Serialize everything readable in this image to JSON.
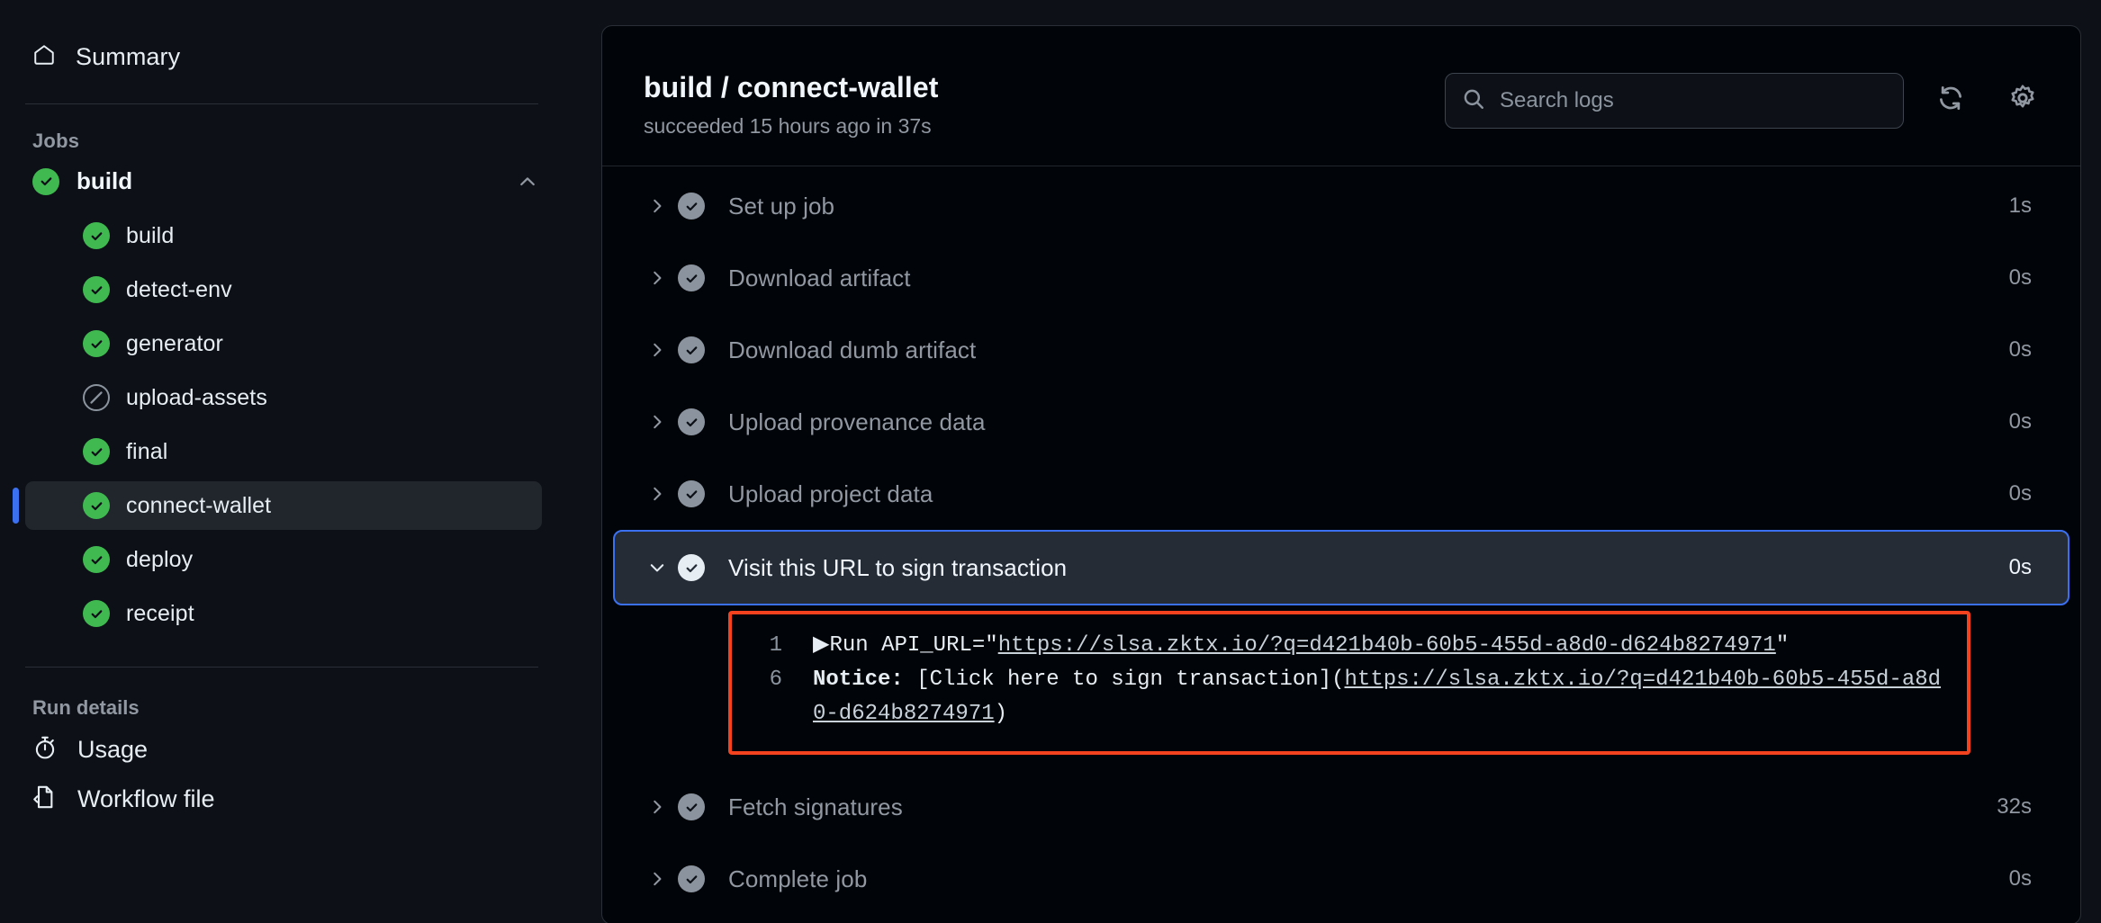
{
  "sidebar": {
    "summary": {
      "label": "Summary",
      "icon": "home-icon"
    },
    "jobs_heading": "Jobs",
    "job": {
      "label": "build",
      "status": "success",
      "expanded": true,
      "collapse_icon": "chevron-up-icon"
    },
    "steps": [
      {
        "label": "build",
        "status": "success",
        "selected": false
      },
      {
        "label": "detect-env",
        "status": "success",
        "selected": false
      },
      {
        "label": "generator",
        "status": "success",
        "selected": false
      },
      {
        "label": "upload-assets",
        "status": "skipped",
        "selected": false
      },
      {
        "label": "final",
        "status": "success",
        "selected": false
      },
      {
        "label": "connect-wallet",
        "status": "success",
        "selected": true
      },
      {
        "label": "deploy",
        "status": "success",
        "selected": false
      },
      {
        "label": "receipt",
        "status": "success",
        "selected": false
      }
    ],
    "run_details_heading": "Run details",
    "run_details": [
      {
        "label": "Usage",
        "icon": "stopwatch-icon"
      },
      {
        "label": "Workflow file",
        "icon": "file-code-icon"
      }
    ]
  },
  "header": {
    "title": "build / connect-wallet",
    "subtitle": "succeeded 15 hours ago in 37s",
    "search": {
      "placeholder": "Search logs",
      "value": "",
      "icon": "search-icon"
    },
    "refresh_icon": "refresh-icon",
    "settings_icon": "gear-icon"
  },
  "steps": [
    {
      "label": "Set up job",
      "duration": "1s",
      "status": "success",
      "expanded": false
    },
    {
      "label": "Download artifact",
      "duration": "0s",
      "status": "success",
      "expanded": false
    },
    {
      "label": "Download dumb artifact",
      "duration": "0s",
      "status": "success",
      "expanded": false
    },
    {
      "label": "Upload provenance data",
      "duration": "0s",
      "status": "success",
      "expanded": false
    },
    {
      "label": "Upload project data",
      "duration": "0s",
      "status": "success",
      "expanded": false
    },
    {
      "label": "Visit this URL to sign transaction",
      "duration": "0s",
      "status": "success",
      "expanded": true
    },
    {
      "label": "Fetch signatures",
      "duration": "32s",
      "status": "success",
      "expanded": false
    },
    {
      "label": "Complete job",
      "duration": "0s",
      "status": "success",
      "expanded": false
    }
  ],
  "log": {
    "url": "https://slsa.zktx.io/?q=d421b40b-60b5-455d-a8d0-d624b8274971",
    "lines": [
      {
        "number": "1",
        "prefix": "▶Run API_URL=\"",
        "link": "https://slsa.zktx.io/?q=d421b40b-60b5-455d-a8d0-d624b8274971",
        "suffix": "\""
      },
      {
        "number": "6",
        "bold_prefix": "Notice:",
        "prefix": " [Click here to sign transaction](",
        "link": "https://slsa.zktx.io/?q=d421b40b-60b5-455d-a8d0-d624b8274971",
        "suffix": ")"
      }
    ]
  },
  "colors": {
    "page_bg": "#0d1117",
    "panel_bg": "#010409",
    "success_green": "#3fb950",
    "selection_blue": "#3b71f0",
    "annotation_red": "#f4411e",
    "muted_text": "#9198a1",
    "primary_text": "#f0f6fc"
  }
}
